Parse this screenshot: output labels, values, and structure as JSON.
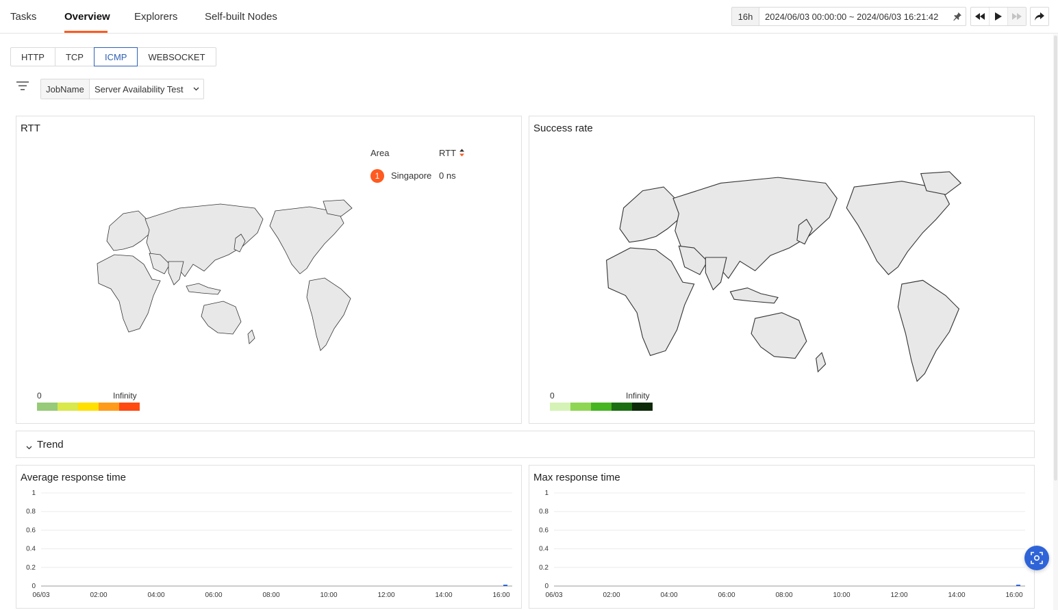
{
  "nav": {
    "tabs": [
      {
        "label": "Tasks"
      },
      {
        "label": "Overview",
        "active": true
      },
      {
        "label": "Explorers"
      },
      {
        "label": "Self-built Nodes"
      }
    ],
    "accent_color": "#ff5a1f"
  },
  "time": {
    "quick": "16h",
    "range": "2024/06/03 00:00:00 ~ 2024/06/03 16:21:42",
    "icons": [
      "pin-icon",
      "rewind-icon",
      "play-icon",
      "fast-forward-icon",
      "share-icon"
    ]
  },
  "protocols": {
    "tabs": [
      "HTTP",
      "TCP",
      "ICMP",
      "WEBSOCKET"
    ],
    "selected": "ICMP",
    "selected_color": "#2f5fb3"
  },
  "filter": {
    "label": "JobName",
    "value": "Server Availability Test"
  },
  "rtt_panel": {
    "title": "RTT",
    "table": {
      "headers": [
        "Area",
        "RTT"
      ],
      "rows": [
        {
          "rank": "1",
          "area": "Singapore",
          "value": "0 ns"
        }
      ]
    },
    "legend": {
      "min": "0",
      "max": "Infinity",
      "colors": [
        "#97ca79",
        "#d9e84a",
        "#ffe000",
        "#ff9b1a",
        "#ff4a12"
      ]
    }
  },
  "success_panel": {
    "title": "Success rate",
    "legend": {
      "min": "0",
      "max": "Infinity",
      "colors": [
        "#d5f3b6",
        "#8fd654",
        "#47b521",
        "#1b6e12",
        "#0d2a08"
      ]
    }
  },
  "trend": {
    "label": "Trend"
  },
  "avg_chart": {
    "title": "Average response time",
    "chart_data": {
      "type": "line",
      "x": [
        "06/03",
        "02:00",
        "04:00",
        "06:00",
        "08:00",
        "10:00",
        "12:00",
        "14:00",
        "16:00"
      ],
      "yticks": [
        "1",
        "0.8",
        "0.6",
        "0.4",
        "0.2",
        "0"
      ],
      "ylim": [
        0,
        1
      ],
      "series": [
        {
          "values_note": "",
          "points": [
            {
              "x": "16:00",
              "y": 0
            }
          ]
        }
      ],
      "grid": true
    }
  },
  "max_chart": {
    "title": "Max response time",
    "chart_data": {
      "type": "line",
      "x": [
        "06/03",
        "02:00",
        "04:00",
        "06:00",
        "08:00",
        "10:00",
        "12:00",
        "14:00",
        "16:00"
      ],
      "yticks": [
        "1",
        "0.8",
        "0.6",
        "0.4",
        "0.2",
        "0"
      ],
      "ylim": [
        0,
        1
      ],
      "series": [
        {
          "values_note": "",
          "points": [
            {
              "x": "16:00",
              "y": 0
            }
          ]
        }
      ],
      "grid": true
    }
  },
  "float_button": {
    "icon": "screenshot-icon"
  }
}
